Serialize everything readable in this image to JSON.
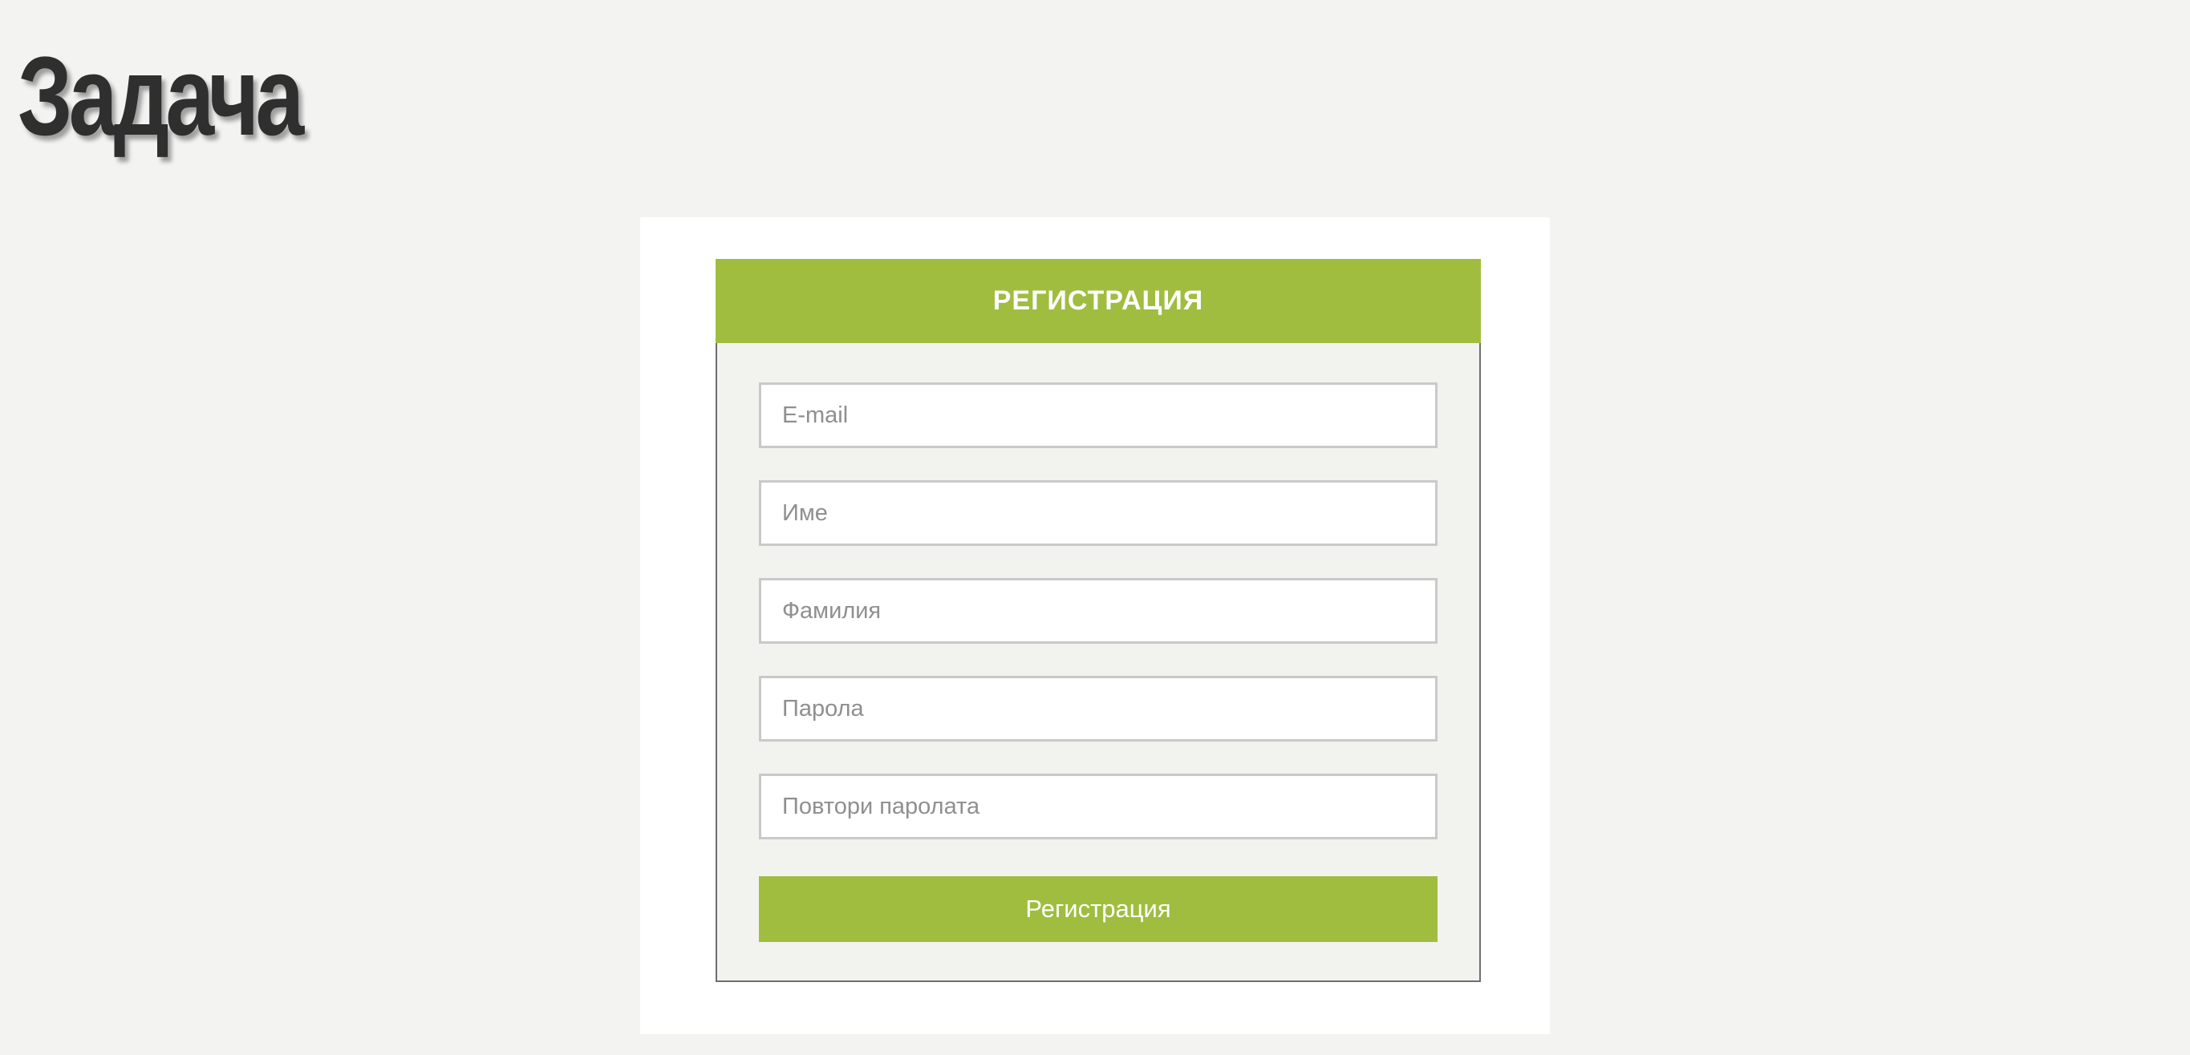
{
  "title": "Задача",
  "form": {
    "header": "РЕГИСТРАЦИЯ",
    "fields": [
      {
        "placeholder": "E-mail",
        "value": ""
      },
      {
        "placeholder": "Име",
        "value": ""
      },
      {
        "placeholder": "Фамилия",
        "value": ""
      },
      {
        "placeholder": "Парола",
        "value": ""
      },
      {
        "placeholder": "Повтори паролата",
        "value": ""
      }
    ],
    "submit_label": "Регистрация"
  },
  "colors": {
    "accent": "#a0bd40",
    "background": "#f3f4f2",
    "card_background": "#f2f3ee",
    "title": "#2f2f2f"
  }
}
